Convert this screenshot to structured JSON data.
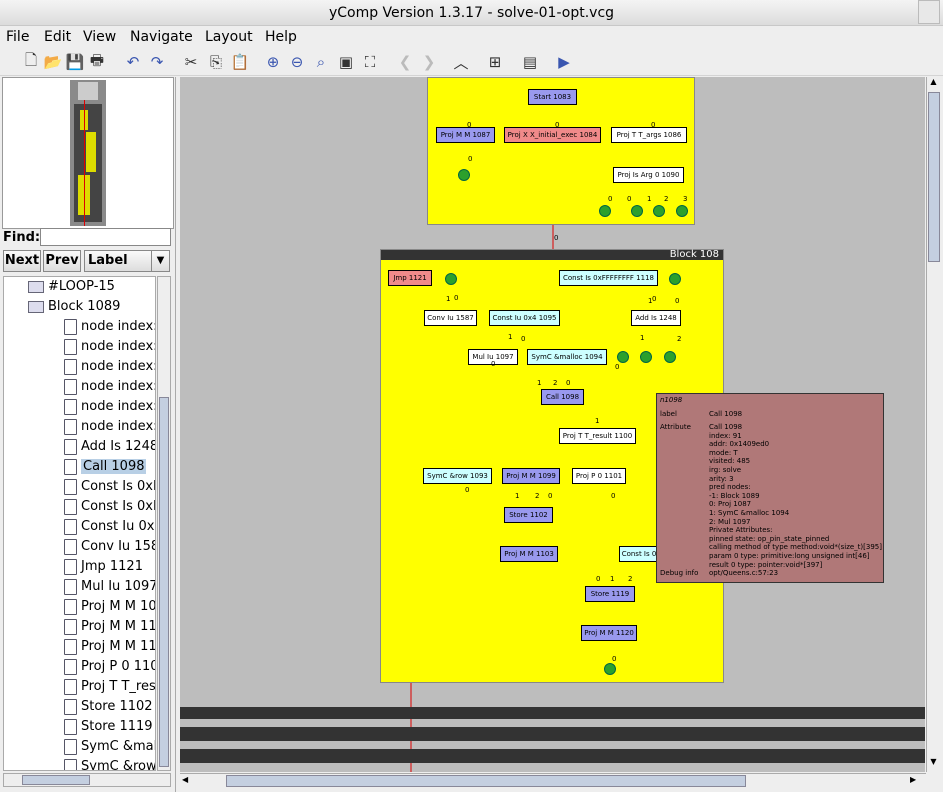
{
  "window": {
    "title": "yComp Version 1.3.17 - solve-01-opt.vcg"
  },
  "menu": {
    "file": "File",
    "edit": "Edit",
    "view": "View",
    "navigate": "Navigate",
    "layout": "Layout",
    "help": "Help"
  },
  "find": {
    "label": "Find:",
    "value": "",
    "next": "Next",
    "prev": "Prev",
    "mode": "Label"
  },
  "tree": [
    {
      "label": "#LOOP-15",
      "depth": 1,
      "type": "folder"
    },
    {
      "label": "Block  1089",
      "depth": 1,
      "type": "folder"
    },
    {
      "label": "node index:",
      "depth": 2,
      "type": "leaf"
    },
    {
      "label": "node index:",
      "depth": 2,
      "type": "leaf"
    },
    {
      "label": "node index:",
      "depth": 2,
      "type": "leaf"
    },
    {
      "label": "node index:",
      "depth": 2,
      "type": "leaf"
    },
    {
      "label": "node index:",
      "depth": 2,
      "type": "leaf"
    },
    {
      "label": "node index:",
      "depth": 2,
      "type": "leaf"
    },
    {
      "label": "Add Is 1248",
      "depth": 2,
      "type": "leaf"
    },
    {
      "label": "Call  1098",
      "depth": 2,
      "type": "leaf",
      "selected": true
    },
    {
      "label": "Const Is 0xF",
      "depth": 2,
      "type": "leaf"
    },
    {
      "label": "Const Is 0xF",
      "depth": 2,
      "type": "leaf"
    },
    {
      "label": "Const Iu 0x4",
      "depth": 2,
      "type": "leaf"
    },
    {
      "label": "Conv Iu 158",
      "depth": 2,
      "type": "leaf"
    },
    {
      "label": "Jmp  1121",
      "depth": 2,
      "type": "leaf"
    },
    {
      "label": "Mul Iu 1097",
      "depth": 2,
      "type": "leaf"
    },
    {
      "label": "Proj M M 10",
      "depth": 2,
      "type": "leaf"
    },
    {
      "label": "Proj M M 11",
      "depth": 2,
      "type": "leaf"
    },
    {
      "label": "Proj M M 11",
      "depth": 2,
      "type": "leaf"
    },
    {
      "label": "Proj P 0 110",
      "depth": 2,
      "type": "leaf"
    },
    {
      "label": "Proj T T_res",
      "depth": 2,
      "type": "leaf"
    },
    {
      "label": "Store  1102",
      "depth": 2,
      "type": "leaf"
    },
    {
      "label": "Store  1119",
      "depth": 2,
      "type": "leaf"
    },
    {
      "label": "SymC &mall",
      "depth": 2,
      "type": "leaf"
    },
    {
      "label": "SymC &row",
      "depth": 2,
      "type": "leaf"
    }
  ],
  "graph": {
    "block_title": "Block  108",
    "top_nodes": [
      {
        "label": "Start  1083",
        "cls": "nb"
      },
      {
        "label": "Proj M M 1087",
        "cls": "nb"
      },
      {
        "label": "Proj X X_initial_exec 1084",
        "cls": "nr"
      },
      {
        "label": "Proj T T_args 1086",
        "cls": "nw"
      },
      {
        "label": "Proj Is Arg 0 1090",
        "cls": "nw"
      }
    ],
    "block_nodes": [
      {
        "label": "Jmp  1121",
        "cls": "nr"
      },
      {
        "label": "Const Is 0xFFFFFFFF 1118",
        "cls": "nc"
      },
      {
        "label": "Conv Iu 1587",
        "cls": "nw"
      },
      {
        "label": "Const Iu 0x4 1095",
        "cls": "nc"
      },
      {
        "label": "Add Is 1248",
        "cls": "nw"
      },
      {
        "label": "Mul Iu 1097",
        "cls": "nw"
      },
      {
        "label": "SymC &malloc  1094",
        "cls": "nc"
      },
      {
        "label": "Call  1098",
        "cls": "nb"
      },
      {
        "label": "Proj T T_result 1100",
        "cls": "nw"
      },
      {
        "label": "SymC &row  1093",
        "cls": "nc"
      },
      {
        "label": "Proj M M 1099",
        "cls": "nb"
      },
      {
        "label": "Proj P 0 1101",
        "cls": "nw"
      },
      {
        "label": "Store  1102",
        "cls": "nb"
      },
      {
        "label": "Proj M M 1103",
        "cls": "nb"
      },
      {
        "label": "Const Is 0",
        "cls": "nc"
      },
      {
        "label": "Store  1119",
        "cls": "nb"
      },
      {
        "label": "Proj M M 1120",
        "cls": "nb"
      }
    ],
    "edge_labels": [
      "0",
      "0",
      "0",
      "0",
      "0",
      "0",
      "1",
      "2",
      "3",
      "0",
      "0",
      "1",
      "0",
      "1",
      "0",
      "1",
      "0",
      "1",
      "2",
      "0",
      "1",
      "2",
      "0",
      "0",
      "1",
      "0",
      "1",
      "2",
      "0",
      "0",
      "0",
      "1",
      "2",
      "0"
    ]
  },
  "tooltip": {
    "id": "n1098",
    "label_key": "label",
    "label_val": "Call 1098",
    "attr_key": "Attribute",
    "attrs": [
      "Call 1098",
      "index: 91",
      "addr: 0x1409ed0",
      "mode: T",
      "visited: 485",
      "irg: solve",
      "arity: 3",
      "pred nodes:",
      "-1: Block 1089",
      "0: Proj 1087",
      "1: SymC &malloc 1094",
      "2: Mul 1097",
      "Private Attributes:",
      "pinned state: op_pin_state_pinned",
      "calling method of type method:void*(size_t)[395]",
      "param 0 type: primitive:long unsigned int[46]",
      "result 0 type: pointer:void*[397]"
    ],
    "debug_key": "Debug info",
    "debug_val": "opt/Queens.c:57:23"
  }
}
